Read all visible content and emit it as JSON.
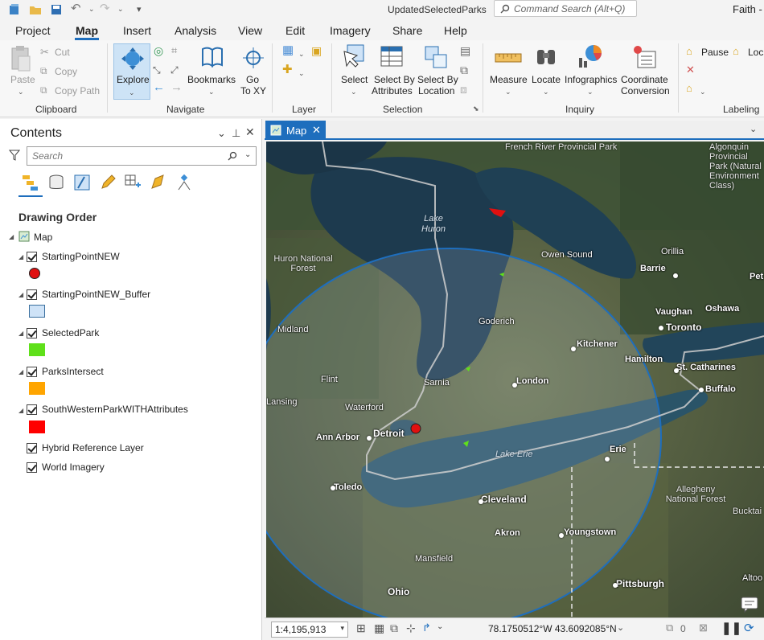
{
  "window": {
    "doc_title": "UpdatedSelectedParks",
    "user": "Faith - F"
  },
  "command_search": {
    "placeholder": "Command Search (Alt+Q)"
  },
  "tabs": [
    "Project",
    "Map",
    "Insert",
    "Analysis",
    "View",
    "Edit",
    "Imagery",
    "Share",
    "Help"
  ],
  "ribbon": {
    "clipboard": {
      "label": "Clipboard",
      "paste": "Paste",
      "cut": "Cut",
      "copy": "Copy",
      "copy_path": "Copy Path"
    },
    "navigate": {
      "label": "Navigate",
      "explore": "Explore",
      "bookmarks": "Bookmarks",
      "go_to_xy_1": "Go",
      "go_to_xy_2": "To XY"
    },
    "layer": {
      "label": "Layer"
    },
    "selection": {
      "label": "Selection",
      "select": "Select",
      "select_by_attr_1": "Select By",
      "select_by_attr_2": "Attributes",
      "select_by_loc_1": "Select By",
      "select_by_loc_2": "Location"
    },
    "inquiry": {
      "label": "Inquiry",
      "measure": "Measure",
      "locate": "Locate",
      "infographics": "Infographics",
      "coord_conv_1": "Coordinate",
      "coord_conv_2": "Conversion"
    },
    "labeling": {
      "label": "Labeling",
      "pause": "Pause",
      "lock": "Lock"
    }
  },
  "contents": {
    "title": "Contents",
    "search_placeholder": "Search",
    "section": "Drawing Order",
    "map_node": "Map",
    "layers": [
      {
        "name": "StartingPointNEW"
      },
      {
        "name": "StartingPointNEW_Buffer"
      },
      {
        "name": "SelectedPark"
      },
      {
        "name": "ParksIntersect"
      },
      {
        "name": "SouthWesternParkWITHAttributes"
      },
      {
        "name": "Hybrid Reference Layer"
      },
      {
        "name": "World Imagery"
      }
    ]
  },
  "map_view": {
    "tab": "Map",
    "scale": "1:4,195,913",
    "coordinates": "78.1750512°W 43.6092085°N",
    "selection_count": "0",
    "labels": {
      "french_river": "French River Provincial Park",
      "algonquin": "Algonquin Provincial Park (Natural Environment Class)",
      "lake_huron": "Lake Huron",
      "huron_forest": "Huron National Forest",
      "owen_sound": "Owen Sound",
      "orillia": "Orillia",
      "barrie": "Barrie",
      "pet": "Pet",
      "midland": "Midland",
      "goderich": "Goderich",
      "vaughan": "Vaughan",
      "oshawa": "Oshawa",
      "toronto": "Toronto",
      "kitchener": "Kitchener",
      "hamilton": "Hamilton",
      "st_catharines": "St. Catharines",
      "flint": "Flint",
      "sarnia": "Sarnia",
      "london": "London",
      "lansing": "Lansing",
      "buffalo": "Buffalo",
      "waterford": "Waterford",
      "ann_arbor": "Ann Arbor",
      "detroit": "Detroit",
      "erie": "Erie",
      "lake_erie": "Lake Erie",
      "toledo": "Toledo",
      "cleveland": "Cleveland",
      "allegheny": "Allegheny National Forest",
      "bucktail": "Bucktai",
      "akron": "Akron",
      "youngstown": "Youngstown",
      "mansfield": "Mansfield",
      "pittsburgh": "Pittsburgh",
      "altoona": "Altoo",
      "ohio": "Ohio"
    }
  },
  "colors": {
    "accent": "#1e6ebd",
    "starting_point": "#e01010",
    "buffer": "#cfe3f7",
    "selected_park": "#5fe01a",
    "parks_intersect": "#ffa500",
    "southwestern_park": "#ff0000"
  }
}
